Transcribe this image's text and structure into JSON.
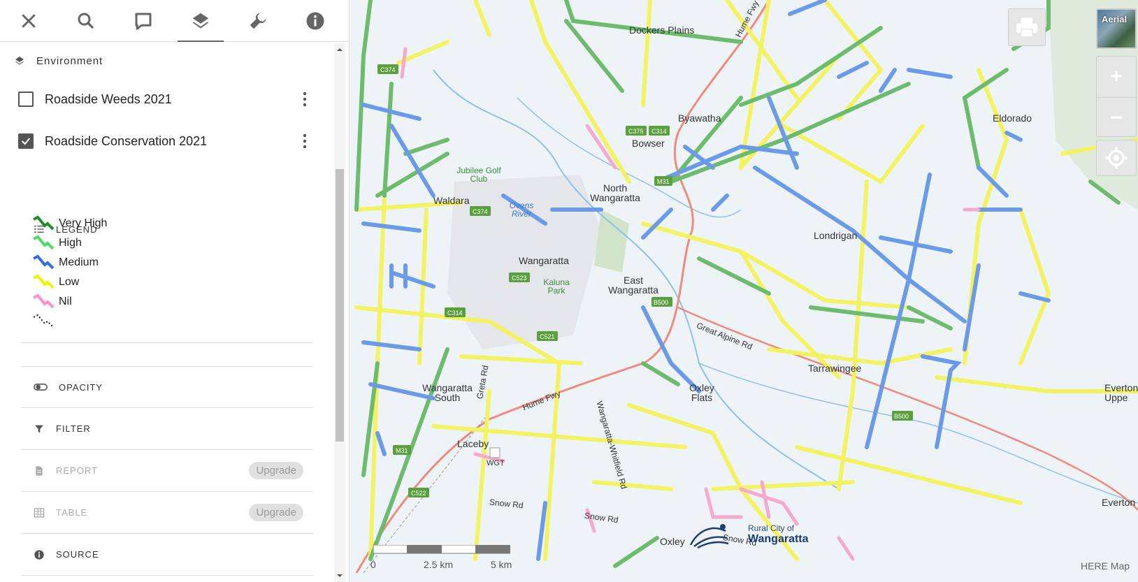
{
  "toolbar": {
    "icons": [
      "close-icon",
      "search-icon",
      "comment-icon",
      "layers-icon",
      "wrench-icon",
      "info-icon"
    ]
  },
  "panel": {
    "section_title": "Environment",
    "layers": [
      {
        "name": "Roadside Weeds 2021",
        "checked": false
      },
      {
        "name": "Roadside Conservation 2021",
        "checked": true
      }
    ],
    "legend_title": "LEGEND",
    "legend": [
      {
        "label": "Very High",
        "color": "#1e8c2a"
      },
      {
        "label": "High",
        "color": "#4cd964"
      },
      {
        "label": "Medium",
        "color": "#2f6fe0"
      },
      {
        "label": "Low",
        "color": "#f2f200"
      },
      {
        "label": "Nil",
        "color": "#ff8fc8"
      },
      {
        "label": "",
        "color": "#111111"
      }
    ],
    "opacity_label": "OPACITY",
    "filter_label": "FILTER",
    "report_label": "REPORT",
    "table_label": "TABLE",
    "upgrade_label": "Upgrade",
    "source_label": "SOURCE"
  },
  "map": {
    "places": [
      "Dockers Plains",
      "Byawatha",
      "Bowser",
      "North Wangaratta",
      "Eldorado",
      "Jubilee Golf Club",
      "Waldara",
      "Ovens River",
      "Wangaratta",
      "Kaluna Park",
      "East Wangaratta",
      "Londrigan",
      "Tarrawingee",
      "Wangaratta South",
      "Oxley Flats",
      "Laceby",
      "WGT",
      "Everton Uppe",
      "Everton"
    ],
    "roads": [
      "Hume Fwy",
      "Great Alpine Rd",
      "Greta Rd",
      "Wangaratta-Whitfield Rd",
      "Snow Rd",
      "Snow Rd",
      "Hume Fwy",
      "Snow Rd"
    ],
    "aerial_label": "Aerial",
    "zoom_in": "+",
    "zoom_out": "−",
    "scale_labels": [
      "0",
      "2.5 km",
      "5 km"
    ],
    "credit": "HERE Map",
    "logo_line1": "Rural City of",
    "logo_line2": "Wangaratta",
    "logo_word": "Oxley"
  }
}
